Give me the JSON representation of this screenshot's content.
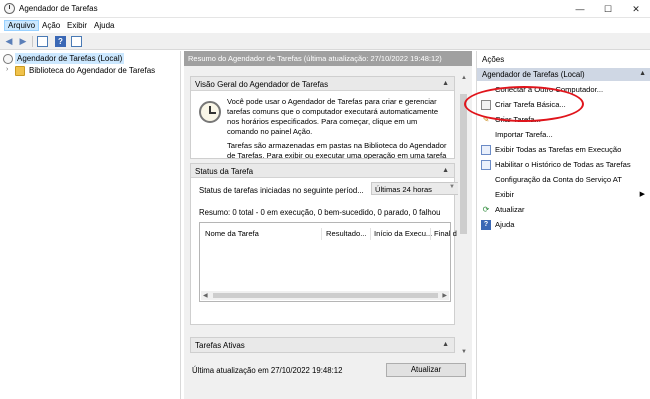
{
  "window": {
    "title": "Agendador de Tarefas",
    "minimize": "—",
    "maximize": "☐",
    "close": "✕"
  },
  "menu": [
    "Arquivo",
    "Ação",
    "Exibir",
    "Ajuda"
  ],
  "tree": {
    "root": "Agendador de Tarefas (Local)",
    "child": "Biblioteca do Agendador de Tarefas"
  },
  "center": {
    "header": "Resumo do Agendador de Tarefas (última atualização: 27/10/2022 19:48:12)",
    "overview": {
      "title": "Visão Geral do Agendador de Tarefas",
      "p1": "Você pode usar o Agendador de Tarefas para criar e gerenciar tarefas comuns que o computador executará automaticamente nos horários especificados. Para começar, clique em um comando no painel Ação.",
      "p2": "Tarefas são armazenadas em pastas na Biblioteca do Agendador de Tarefas. Para exibir ou executar uma operação em uma tarefa"
    },
    "status": {
      "title": "Status da Tarefa",
      "label": "Status de tarefas iniciadas no seguinte períod...",
      "period": "Últimas 24 horas",
      "summary": "Resumo: 0 total - 0 em execução, 0 bem-sucedido, 0 parado, 0 falhou",
      "columns": [
        "Nome da Tarefa",
        "Resultado...",
        "Início da Execu...",
        "Final d"
      ]
    },
    "active": {
      "title": "Tarefas Ativas"
    },
    "footer": {
      "last_update": "Última atualização em 27/10/2022 19:48:12",
      "refresh": "Atualizar"
    }
  },
  "actions": {
    "title": "Ações",
    "group": "Agendador de Tarefas (Local)",
    "items": [
      "Conectar a Outro Computador...",
      "Criar Tarefa Básica...",
      "Criar Tarefa...",
      "Importar Tarefa...",
      "Exibir Todas as Tarefas em Execução",
      "Habilitar o Histórico de Todas as Tarefas",
      "Configuração da Conta do Serviço AT",
      "Exibir",
      "Atualizar",
      "Ajuda"
    ]
  },
  "colors": {
    "highlight": "#e0141b",
    "selected": "#cce8ff",
    "header_gray": "#a0a0a0"
  },
  "icons": [
    "scheduler-clock-icon",
    "folder-icon",
    "back-icon",
    "forward-icon",
    "console-icon",
    "help-icon",
    "refresh-icon"
  ]
}
